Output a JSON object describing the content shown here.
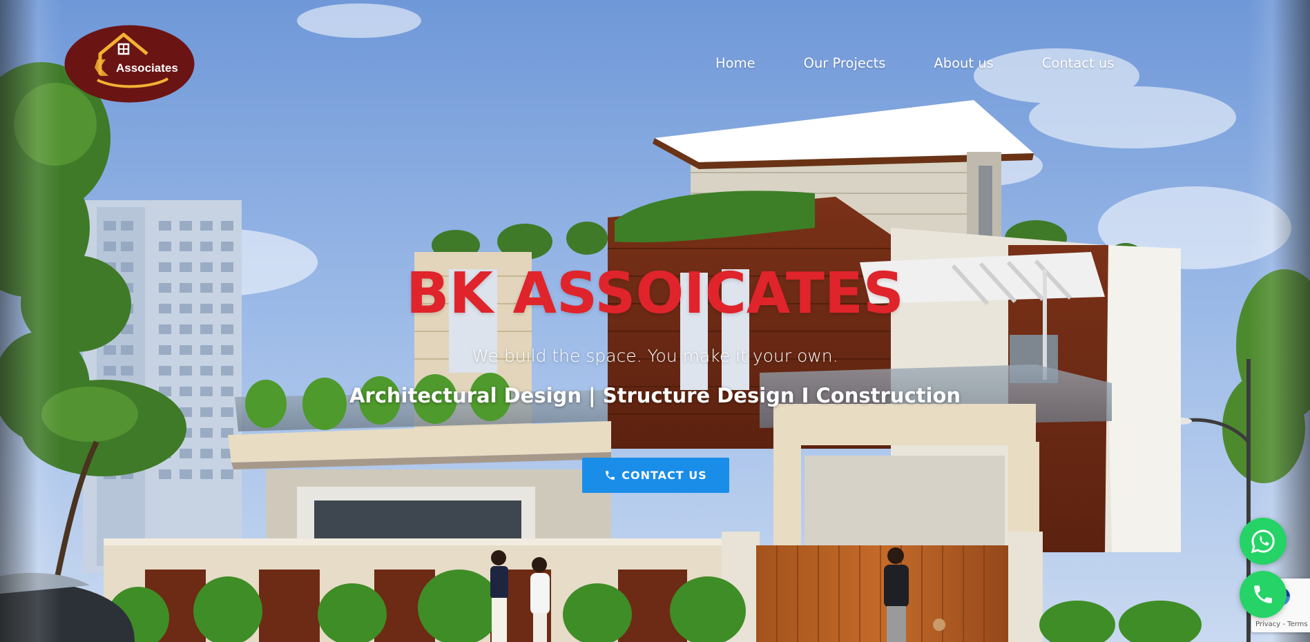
{
  "brand": {
    "logo_text": "Associates",
    "logo_colors": {
      "oval": "#6b1414",
      "house": "#f2b233",
      "text": "#ffffff"
    }
  },
  "nav": {
    "items": [
      {
        "label": "Home"
      },
      {
        "label": "Our Projects"
      },
      {
        "label": "About us"
      },
      {
        "label": "Contact us"
      }
    ]
  },
  "hero": {
    "title": "BK ASSOICATES",
    "tagline": "We build the space. You make it your own.",
    "services": "Architectural Design | Structure Design I Construction",
    "cta_label": "CONTACT US",
    "cta_icon": "phone-icon"
  },
  "floating": {
    "whatsapp_icon": "whatsapp-icon",
    "phone_icon": "phone-icon"
  },
  "recaptcha": {
    "text": "Privacy - Terms"
  },
  "colors": {
    "title_red": "#e0242b",
    "cta_blue": "#1a8de9",
    "whatsapp_green": "#25d366"
  }
}
